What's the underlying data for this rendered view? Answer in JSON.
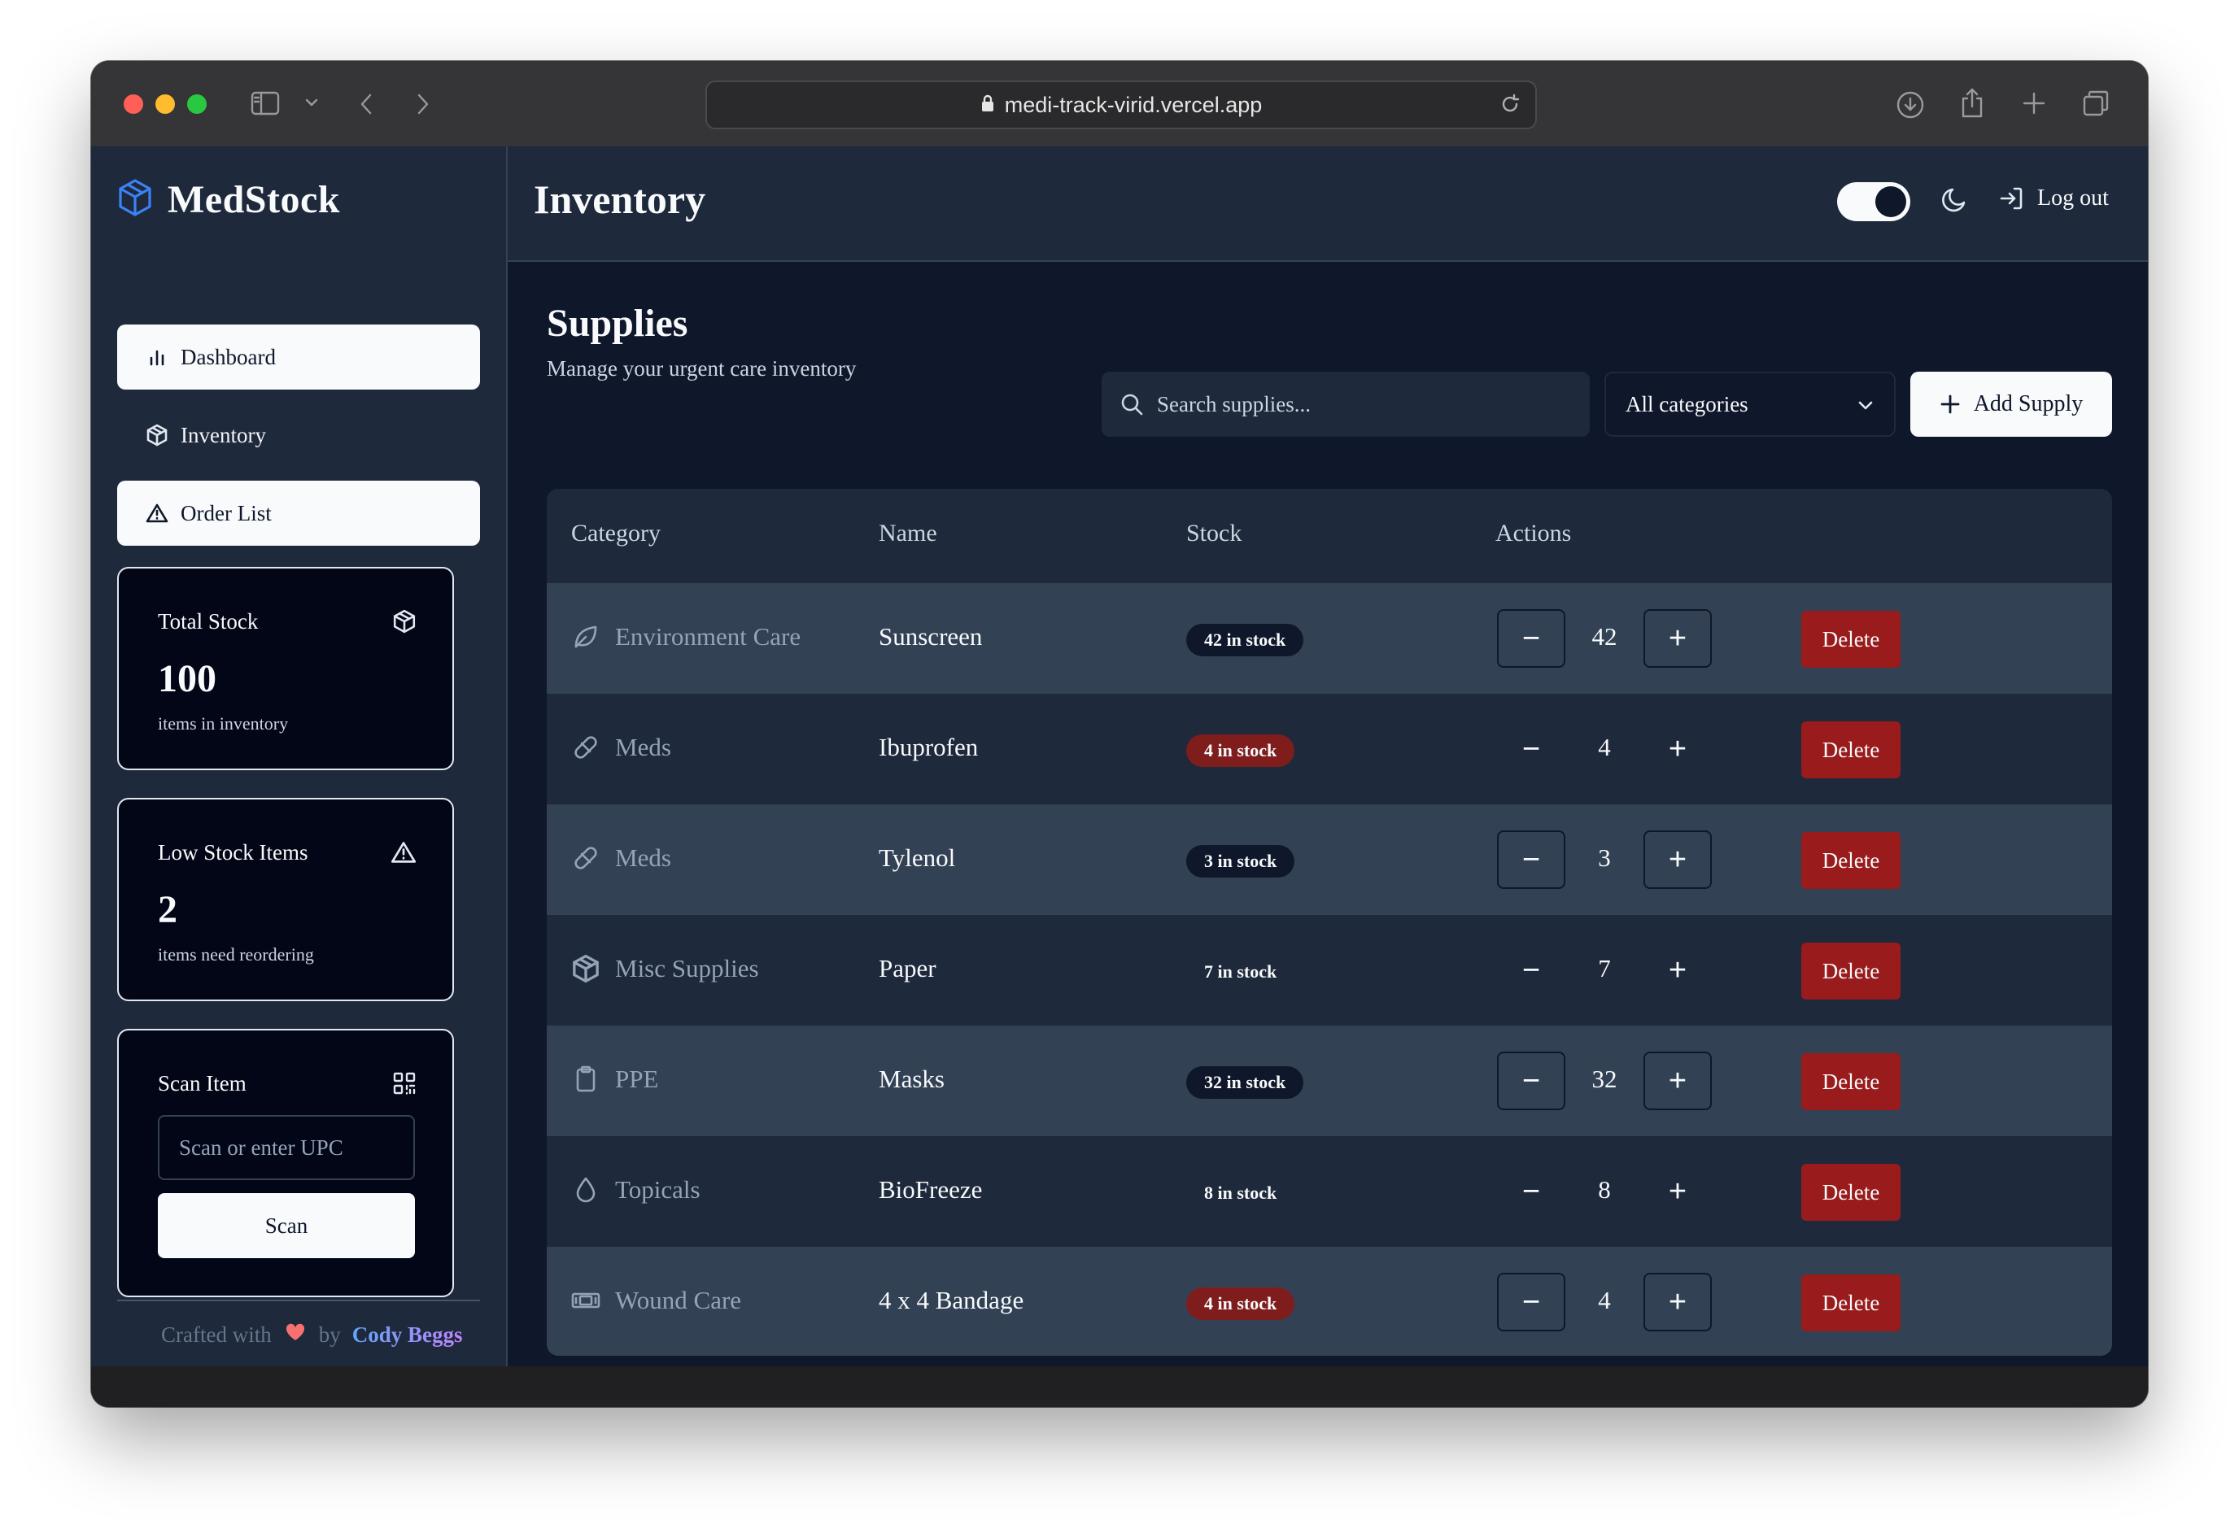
{
  "browser": {
    "url": "medi-track-virid.vercel.app"
  },
  "sidebar": {
    "brand": "MedStock",
    "nav": [
      {
        "label": "Dashboard",
        "icon": "bar-chart-icon"
      },
      {
        "label": "Inventory",
        "icon": "package-icon"
      },
      {
        "label": "Order List",
        "icon": "alert-triangle-icon"
      }
    ],
    "cards": {
      "total_stock": {
        "title": "Total Stock",
        "value": "100",
        "sub": "items in inventory",
        "icon": "package-icon"
      },
      "low_stock": {
        "title": "Low Stock Items",
        "value": "2",
        "sub": "items need reordering",
        "icon": "alert-triangle-icon"
      },
      "scan": {
        "title": "Scan Item",
        "placeholder": "Scan or enter UPC",
        "button": "Scan",
        "icon": "qr-code-icon"
      }
    },
    "footer": {
      "prefix": "Crafted with",
      "by": "by",
      "author": "Cody Beggs"
    }
  },
  "header": {
    "title": "Inventory",
    "theme_toggle_on": true,
    "logout": "Log out"
  },
  "supplies": {
    "title": "Supplies",
    "subtitle": "Manage your urgent care inventory",
    "search_placeholder": "Search supplies...",
    "category_filter": "All categories",
    "add_button": "Add Supply"
  },
  "table": {
    "columns": [
      "Category",
      "Name",
      "Stock",
      "Actions"
    ],
    "delete_label": "Delete",
    "rows": [
      {
        "category": "Environment Care",
        "icon": "leaf-icon",
        "name": "Sunscreen",
        "stock": "42 in stock",
        "qty": "42"
      },
      {
        "category": "Meds",
        "icon": "pill-icon",
        "name": "Ibuprofen",
        "stock": "4 in stock",
        "qty": "4"
      },
      {
        "category": "Meds",
        "icon": "pill-icon",
        "name": "Tylenol",
        "stock": "3 in stock",
        "qty": "3"
      },
      {
        "category": "Misc Supplies",
        "icon": "package-icon",
        "name": "Paper",
        "stock": "7 in stock",
        "qty": "7"
      },
      {
        "category": "PPE",
        "icon": "clipboard-icon",
        "name": "Masks",
        "stock": "32 in stock",
        "qty": "32"
      },
      {
        "category": "Topicals",
        "icon": "droplet-icon",
        "name": "BioFreeze",
        "stock": "8 in stock",
        "qty": "8"
      },
      {
        "category": "Wound Care",
        "icon": "bandage-icon",
        "name": "4 x 4 Bandage",
        "stock": "4 in stock",
        "qty": "4"
      }
    ]
  },
  "colors": {
    "accent_blue": "#3b82f6",
    "danger": "#991b1b",
    "low_badge": "#7f1d1d",
    "heart": "#f87171"
  }
}
